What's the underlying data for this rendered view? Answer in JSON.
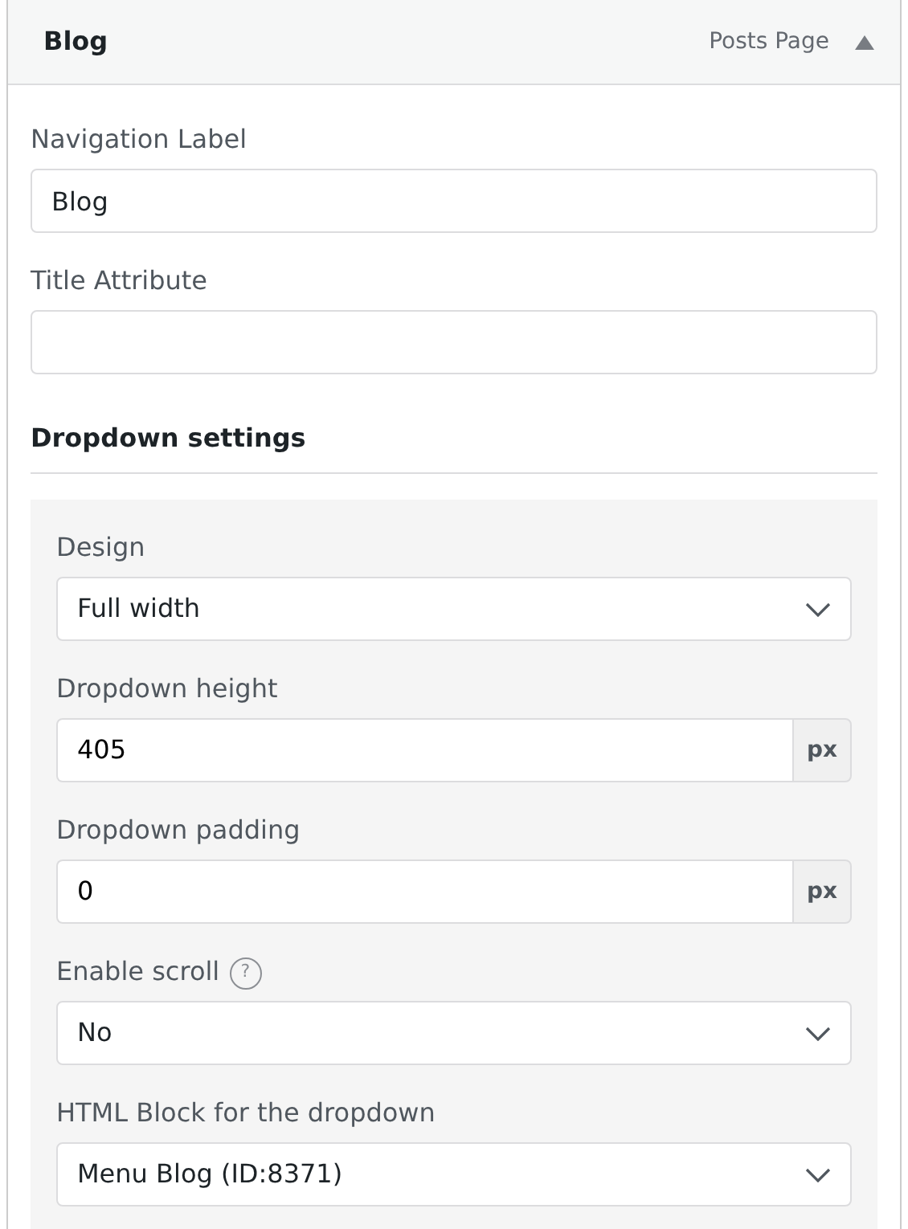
{
  "item": {
    "title": "Blog",
    "type_label": "Posts Page",
    "expanded": true
  },
  "fields": [
    {
      "label": "Navigation Label",
      "value": "Blog"
    },
    {
      "label": "Title Attribute"
    }
  ],
  "section": {
    "title": "Dropdown settings",
    "settings": [
      {
        "kind": "select",
        "label": "Design",
        "value": "Full width"
      },
      {
        "kind": "unit",
        "label": "Dropdown height",
        "value": "405",
        "unit": "px"
      },
      {
        "kind": "unit",
        "label": "Dropdown padding",
        "value": "0",
        "unit": "px"
      },
      {
        "kind": "select",
        "label": "Enable scroll",
        "help": "?",
        "value": "No"
      },
      {
        "kind": "select",
        "label": "HTML Block for the dropdown",
        "value": "Menu Blog (ID:8371)"
      }
    ]
  }
}
